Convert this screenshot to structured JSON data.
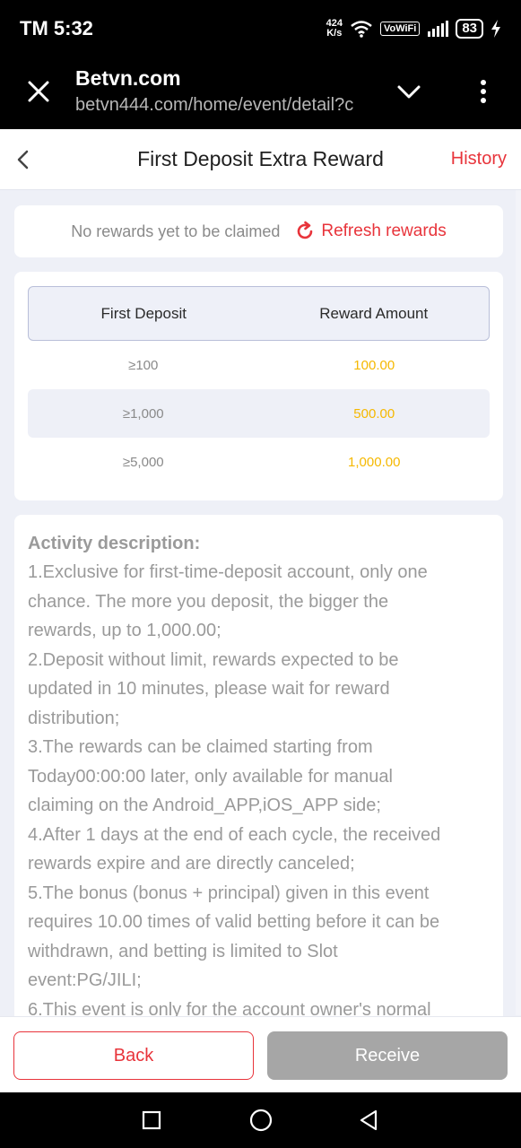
{
  "status_bar": {
    "time": "TM 5:32",
    "speed_value": "424",
    "speed_unit": "K/s",
    "vowifi": "VoWiFi",
    "battery": "83"
  },
  "browser": {
    "site_title": "Betvn.com",
    "url": "betvn444.com/home/event/detail?c"
  },
  "header": {
    "title": "First Deposit Extra Reward",
    "history": "History"
  },
  "rewards_status": {
    "message": "No rewards yet to be claimed",
    "refresh_label": "Refresh rewards"
  },
  "table": {
    "headers": [
      "First Deposit",
      "Reward Amount"
    ],
    "rows": [
      {
        "deposit": "≥100",
        "reward": "100.00"
      },
      {
        "deposit": "≥1,000",
        "reward": "500.00"
      },
      {
        "deposit": "≥5,000",
        "reward": "1,000.00"
      }
    ]
  },
  "description": {
    "title": "Activity description:",
    "lines": [
      "1.Exclusive for first-time-deposit account, only one",
      "chance. The more you deposit, the bigger the",
      "rewards, up to 1,000.00;",
      "2.Deposit without limit, rewards expected to be",
      "updated in 10 minutes, please wait for reward",
      "distribution;",
      "3.The rewards can be claimed starting from",
      "Today00:00:00 later, only available for manual",
      "claiming on the Android_APP,iOS_APP side;",
      "4.After 1 days at the end of each cycle, the received",
      "rewards expire and are directly canceled;",
      "5.The bonus (bonus + principal) given in this event",
      "requires 10.00 times of valid betting before it can be",
      "withdrawn, and betting is limited to Slot",
      "event:PG/JILI;",
      "6.This event is only for the account owner's normal"
    ]
  },
  "actions": {
    "back_label": "Back",
    "receive_label": "Receive"
  },
  "colors": {
    "accent_red": "#e8343b",
    "reward_gold": "#f5b800",
    "disabled_gray": "#a6a6a6"
  }
}
